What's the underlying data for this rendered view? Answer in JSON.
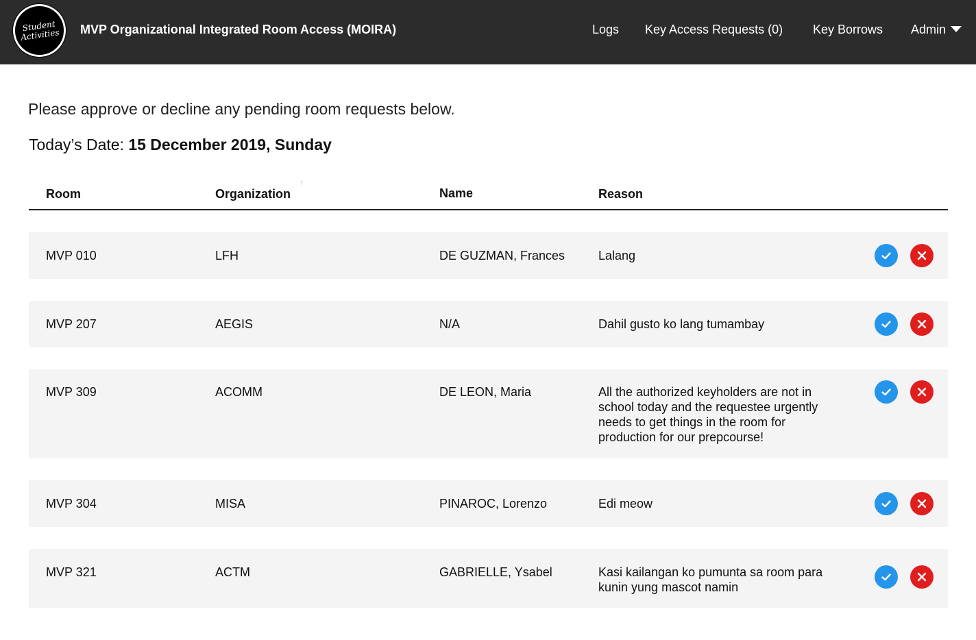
{
  "logo": {
    "line1": "Student",
    "line2": "Activities"
  },
  "app_title": "MVP Organizational Integrated Room Access (MOIRA)",
  "nav": {
    "logs": "Logs",
    "key_access_requests": "Key Access Requests (0)",
    "key_borrows": "Key Borrows",
    "admin": "Admin"
  },
  "intro": "Please approve or decline any pending room requests below.",
  "date": {
    "label": "Today’s Date: ",
    "value": "15 December 2019, Sunday"
  },
  "table": {
    "headers": {
      "room": "Room",
      "organization": "Organization",
      "name": "Name",
      "reason": "Reason"
    },
    "sort_indicator": "↑",
    "rows": [
      {
        "room": "MVP 010",
        "organization": "LFH",
        "name": "DE GUZMAN, Frances",
        "reason": "Lalang"
      },
      {
        "room": "MVP 207",
        "organization": "AEGIS",
        "name": "N/A",
        "reason": "Dahil gusto ko lang tumambay"
      },
      {
        "room": "MVP 309",
        "organization": "ACOMM",
        "name": "DE LEON, Maria",
        "reason": "All the authorized keyholders are not in school today and the requestee urgently needs to get things in the room for production for our prepcourse!"
      },
      {
        "room": "MVP 304",
        "organization": "MISA",
        "name": "PINAROC, Lorenzo",
        "reason": "Edi meow"
      },
      {
        "room": "MVP 321",
        "organization": "ACTM",
        "name": "GABRIELLE, Ysabel",
        "reason": "Kasi kailangan ko pumunta sa room para kunin yung mascot namin"
      }
    ]
  },
  "colors": {
    "topbar": "#2c2c2c",
    "approve": "#2495ea",
    "decline": "#e01e1e",
    "row_bg": "#f4f4f4"
  },
  "icons": {
    "approve": "check-icon",
    "decline": "x-icon",
    "admin_menu": "caret-down-icon"
  }
}
